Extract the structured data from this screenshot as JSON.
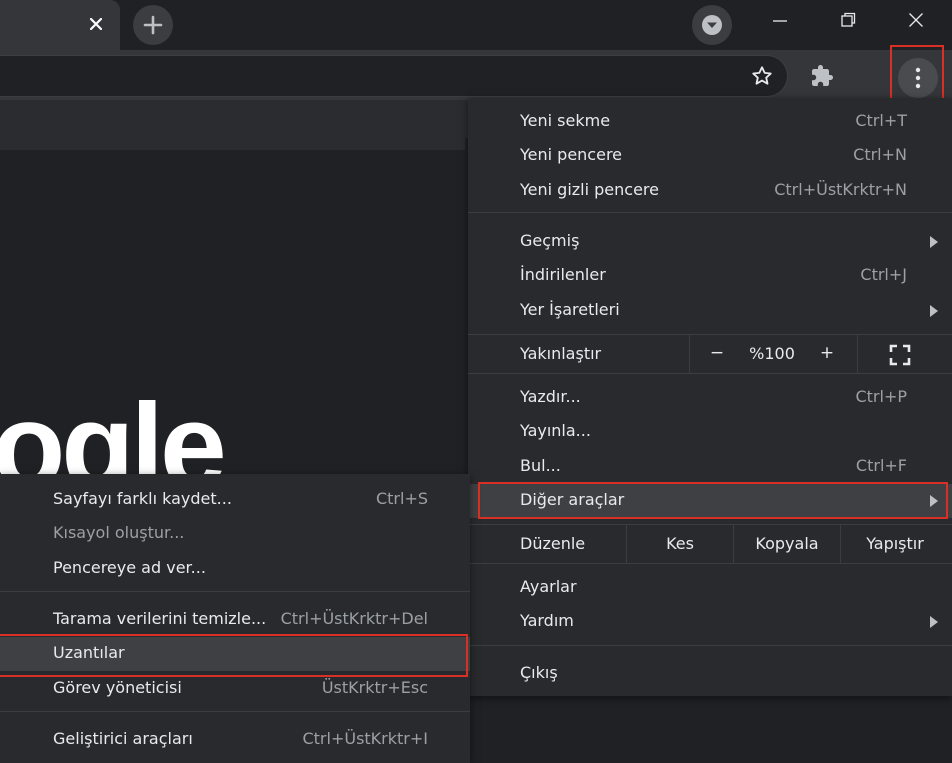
{
  "page": {
    "logo_text": "ogle"
  },
  "main_menu": {
    "items": [
      {
        "label": "Yeni sekme",
        "shortcut": "Ctrl+T"
      },
      {
        "label": "Yeni pencere",
        "shortcut": "Ctrl+N"
      },
      {
        "label": "Yeni gizli pencere",
        "shortcut": "Ctrl+ÜstKrktr+N"
      },
      {
        "label": "Geçmiş",
        "shortcut": ""
      },
      {
        "label": "İndirilenler",
        "shortcut": "Ctrl+J"
      },
      {
        "label": "Yer İşaretleri",
        "shortcut": ""
      },
      {
        "label": "Yazdır...",
        "shortcut": "Ctrl+P"
      },
      {
        "label": "Yayınla...",
        "shortcut": ""
      },
      {
        "label": "Bul...",
        "shortcut": "Ctrl+F"
      },
      {
        "label": "Diğer araçlar",
        "shortcut": ""
      },
      {
        "label": "Ayarlar",
        "shortcut": ""
      },
      {
        "label": "Yardım",
        "shortcut": ""
      },
      {
        "label": "Çıkış",
        "shortcut": ""
      }
    ],
    "zoom": {
      "label": "Yakınlaştır",
      "minus": "−",
      "value": "%100",
      "plus": "+"
    },
    "edit": {
      "label": "Düzenle",
      "cut": "Kes",
      "copy": "Kopyala",
      "paste": "Yapıştır"
    }
  },
  "sub_menu": {
    "items": [
      {
        "label": "Sayfayı farklı kaydet...",
        "shortcut": "Ctrl+S"
      },
      {
        "label": "Kısayol oluştur...",
        "shortcut": ""
      },
      {
        "label": "Pencereye ad ver...",
        "shortcut": ""
      },
      {
        "label": "Tarama verilerini temizle...",
        "shortcut": "Ctrl+ÜstKrktr+Del"
      },
      {
        "label": "Uzantılar",
        "shortcut": ""
      },
      {
        "label": "Görev yöneticisi",
        "shortcut": "ÜstKrktr+Esc"
      },
      {
        "label": "Geliştirici araçları",
        "shortcut": "Ctrl+ÜstKrktr+I"
      }
    ]
  },
  "icons": {
    "tab_close": "close-icon",
    "new_tab": "plus-icon",
    "tab_search": "chevron-down-icon",
    "minimize": "minimize-icon",
    "restore": "restore-icon",
    "window_close": "close-icon",
    "bookmark": "star-icon",
    "extensions": "puzzle-icon",
    "menu": "kebab-menu-icon",
    "fullscreen": "fullscreen-icon"
  },
  "colors": {
    "highlight": "#d93025",
    "menu_bg": "#292a2d",
    "page_bg": "#202124"
  }
}
